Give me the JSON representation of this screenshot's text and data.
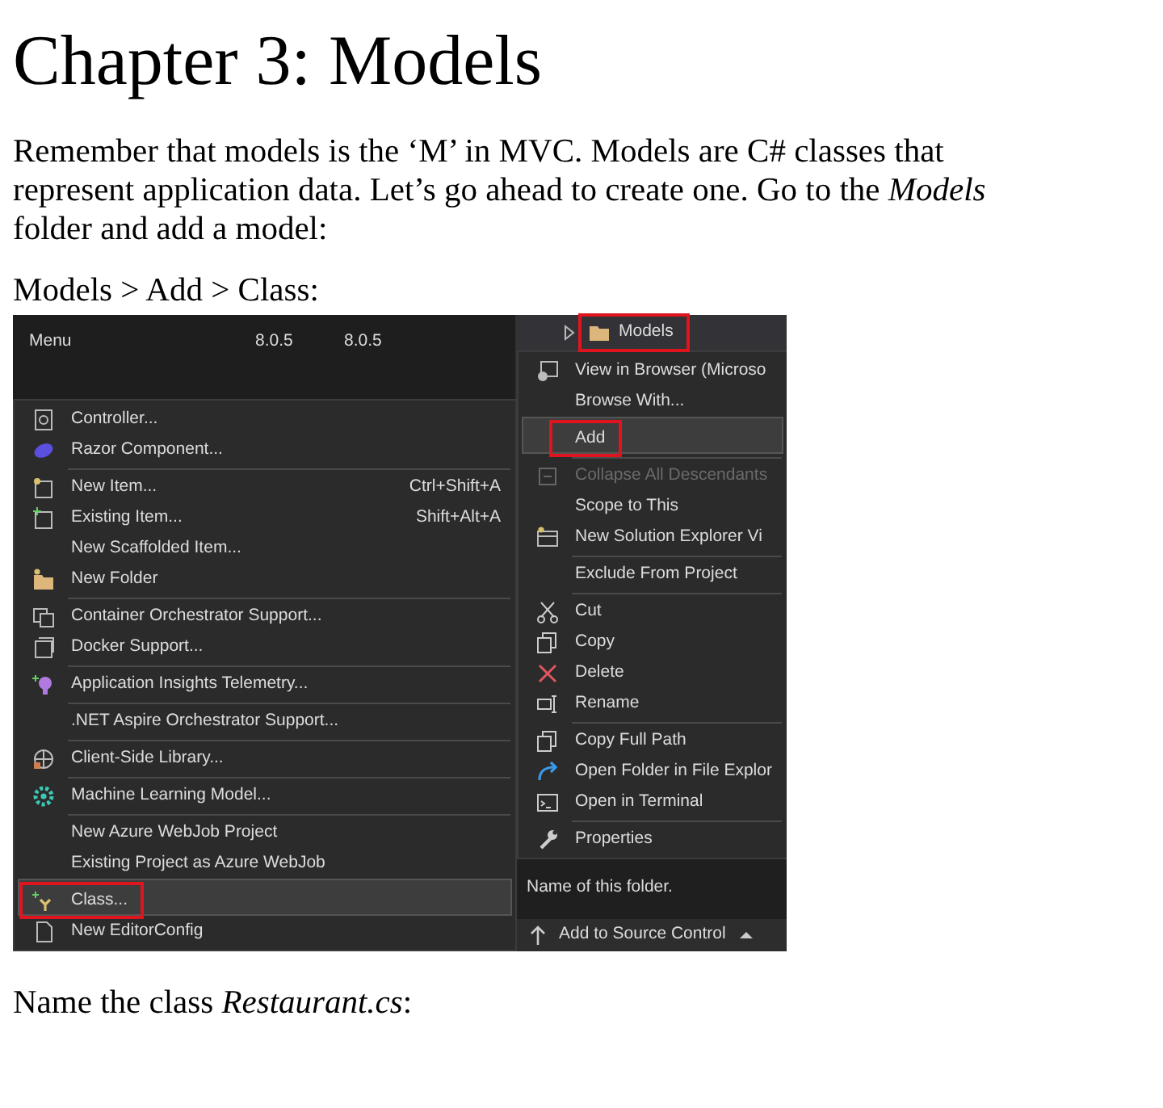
{
  "heading": "Chapter 3: Models",
  "paragraphs": [
    "Remember that models is the ‘M’ in MVC. Models are C# classes that represent application data. Let’s go ahead to create one. Go to the *Models* folder and add a model:",
    "Models > Add > Class:"
  ],
  "screenshot": {
    "package_row": {
      "name": "Menu",
      "columns": [
        "8.0.5",
        "8.0.5"
      ]
    },
    "add_menu": {
      "items": [
        {
          "label": "Controller...",
          "divider_before": false,
          "selected": false,
          "outlined": false
        },
        {
          "label": "Razor Component...",
          "divider_before": false,
          "selected": false,
          "outlined": false
        },
        {
          "label": "New Item...",
          "shortcut": "Ctrl+Shift+A",
          "divider_before": true,
          "selected": false,
          "outlined": false
        },
        {
          "label": "Existing Item...",
          "shortcut": "Shift+Alt+A",
          "divider_before": false,
          "selected": false,
          "outlined": false
        },
        {
          "label": "New Scaffolded Item...",
          "divider_before": false,
          "selected": false,
          "outlined": false
        },
        {
          "label": "New Folder",
          "divider_before": false,
          "selected": false,
          "outlined": false
        },
        {
          "label": "Container Orchestrator Support...",
          "divider_before": true,
          "selected": false,
          "outlined": false
        },
        {
          "label": "Docker Support...",
          "divider_before": false,
          "selected": false,
          "outlined": false
        },
        {
          "label": "Application Insights Telemetry...",
          "divider_before": true,
          "selected": false,
          "outlined": false
        },
        {
          "label": ".NET Aspire Orchestrator Support...",
          "divider_before": true,
          "selected": false,
          "outlined": false
        },
        {
          "label": "Client-Side Library...",
          "divider_before": true,
          "selected": false,
          "outlined": false
        },
        {
          "label": "Machine Learning Model...",
          "divider_before": true,
          "selected": false,
          "outlined": false
        },
        {
          "label": "New Azure WebJob Project",
          "divider_before": true,
          "selected": false,
          "outlined": false
        },
        {
          "label": "Existing Project as Azure WebJob",
          "divider_before": false,
          "selected": false,
          "outlined": false
        },
        {
          "label": "Class...",
          "divider_before": true,
          "selected": true,
          "outlined": true
        },
        {
          "label": "New EditorConfig",
          "divider_before": false,
          "selected": false,
          "outlined": false
        }
      ]
    },
    "tree_item": {
      "label": "Models",
      "selected": true,
      "outlined": true
    },
    "context_menu": {
      "items": [
        {
          "label": "View in Browser (Microso",
          "divider_before": false,
          "selected": false,
          "outlined": false,
          "disabled": false
        },
        {
          "label": "Browse With...",
          "divider_before": false,
          "selected": false,
          "outlined": false,
          "disabled": false
        },
        {
          "label": "Add",
          "divider_before": true,
          "selected": true,
          "outlined": true,
          "disabled": false
        },
        {
          "label": "Collapse All Descendants",
          "divider_before": true,
          "selected": false,
          "outlined": false,
          "disabled": true
        },
        {
          "label": "Scope to This",
          "divider_before": false,
          "selected": false,
          "outlined": false,
          "disabled": false
        },
        {
          "label": "New Solution Explorer Vi",
          "divider_before": false,
          "selected": false,
          "outlined": false,
          "disabled": false
        },
        {
          "label": "Exclude From Project",
          "divider_before": true,
          "selected": false,
          "outlined": false,
          "disabled": false
        },
        {
          "label": "Cut",
          "divider_before": true,
          "selected": false,
          "outlined": false,
          "disabled": false
        },
        {
          "label": "Copy",
          "divider_before": false,
          "selected": false,
          "outlined": false,
          "disabled": false
        },
        {
          "label": "Delete",
          "divider_before": false,
          "selected": false,
          "outlined": false,
          "disabled": false
        },
        {
          "label": "Rename",
          "divider_before": false,
          "selected": false,
          "outlined": false,
          "disabled": false
        },
        {
          "label": "Copy Full Path",
          "divider_before": true,
          "selected": false,
          "outlined": false,
          "disabled": false
        },
        {
          "label": "Open Folder in File Explor",
          "divider_before": false,
          "selected": false,
          "outlined": false,
          "disabled": false
        },
        {
          "label": "Open in Terminal",
          "divider_before": false,
          "selected": false,
          "outlined": false,
          "disabled": false
        },
        {
          "label": "Properties",
          "divider_before": true,
          "selected": false,
          "outlined": false,
          "disabled": false
        }
      ]
    },
    "property_description": "Name of this folder.",
    "status_button": "Add to Source Control"
  },
  "closing": "Name the class *Restaurant.cs*:"
}
